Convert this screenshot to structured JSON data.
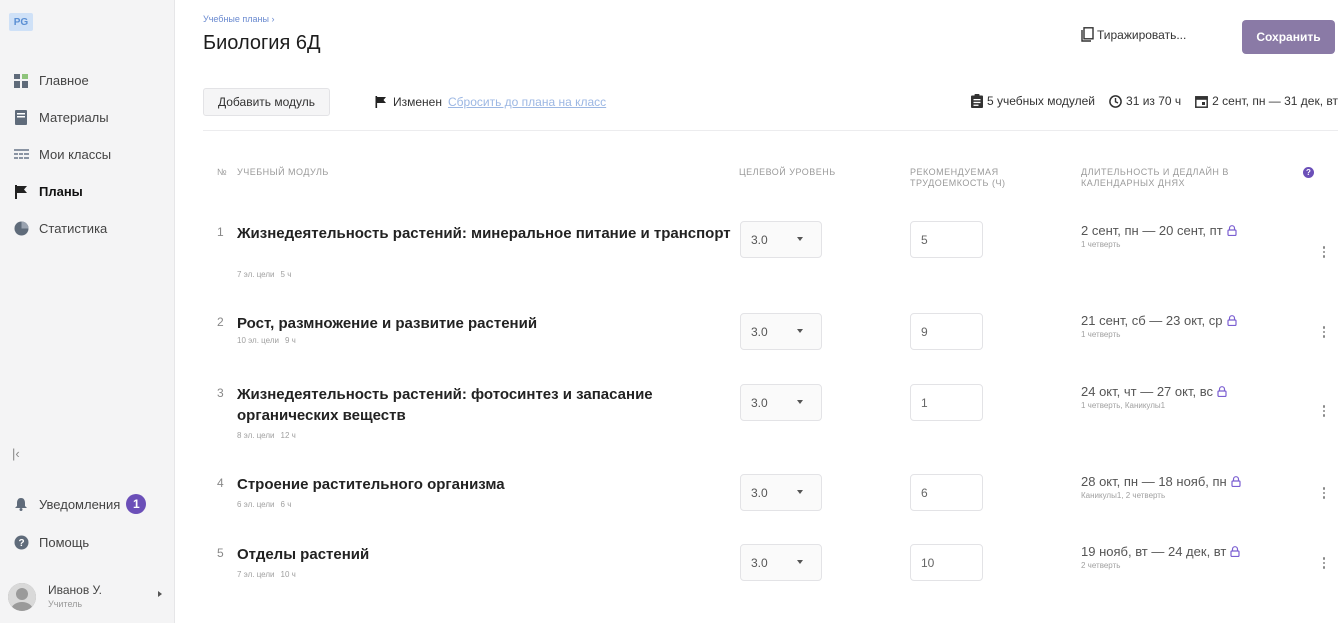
{
  "sidebar": {
    "logo": "PG",
    "items": [
      {
        "label": "Главное",
        "icon": "dashboard-icon"
      },
      {
        "label": "Материалы",
        "icon": "book-icon"
      },
      {
        "label": "Мои классы",
        "icon": "classes-icon"
      },
      {
        "label": "Планы",
        "icon": "flag-icon"
      },
      {
        "label": "Статистика",
        "icon": "chart-pie-icon"
      }
    ],
    "notifications": {
      "label": "Уведомления",
      "count": "1"
    },
    "help": "Помощь",
    "user": {
      "name": "Иванов У.",
      "role": "Учитель"
    }
  },
  "header": {
    "breadcrumb": "Учебные планы ›",
    "title": "Биология 6Д",
    "replicate_label": "Тиражировать...",
    "save_label": "Сохранить"
  },
  "toolbar": {
    "add_module_label": "Добавить модуль",
    "changed_label": "Изменен",
    "reset_link": "Сбросить до плана на класс",
    "stats": {
      "modules": "5 учебных модулей",
      "hours": "31 из 70 ч",
      "dates": "2 сент, пн — 31 дек, вт"
    }
  },
  "table": {
    "col_num": "№",
    "col_module": "УЧЕБНЫЙ МОДУЛЬ",
    "col_level": "ЦЕЛЕВОЙ УРОВЕНЬ",
    "col_hours_1": "РЕКОМЕНДУЕМАЯ",
    "col_hours_2": "ТРУДОЕМКОСТЬ (Ч)",
    "col_deadline_1": "ДЛИТЕЛЬНОСТЬ И ДЕДЛАЙН В",
    "col_deadline_2": "КАЛЕНДАРНЫХ ДНЯХ",
    "rows": [
      {
        "num": "1",
        "title": "Жизнедеятельность растений: минеральное питание и транспорт",
        "goals": "7 эл. цели",
        "hours_meta": "5 ч",
        "level": "3.0",
        "hours": "5",
        "deadline": "2 сент, пн — 20 сент, пт",
        "period": "1 четверть"
      },
      {
        "num": "2",
        "title": "Рост, размножение и развитие растений",
        "goals": "10 эл. цели",
        "hours_meta": "9 ч",
        "level": "3.0",
        "hours": "9",
        "deadline": "21 сент, сб — 23 окт, ср",
        "period": "1 четверть"
      },
      {
        "num": "3",
        "title": "Жизнедеятельность растений: фотосинтез и запасание органических веществ",
        "goals": "8 эл. цели",
        "hours_meta": "12 ч",
        "level": "3.0",
        "hours": "1",
        "deadline": "24 окт, чт — 27 окт, вс",
        "period": "1 четверть, Каникулы1"
      },
      {
        "num": "4",
        "title": "Строение растительного организма",
        "goals": "6 эл. цели",
        "hours_meta": "6 ч",
        "level": "3.0",
        "hours": "6",
        "deadline": "28 окт, пн — 18 нояб, пн",
        "period": "Каникулы1, 2 четверть"
      },
      {
        "num": "5",
        "title": "Отделы растений",
        "goals": "7 эл. цели",
        "hours_meta": "10 ч",
        "level": "3.0",
        "hours": "10",
        "deadline": "19 нояб, вт — 24 дек, вт",
        "period": "2 четверть"
      }
    ]
  },
  "colors": {
    "accent": "#6b4fb8",
    "save_button": "#8a7aa6",
    "link": "#9cb7e3"
  }
}
